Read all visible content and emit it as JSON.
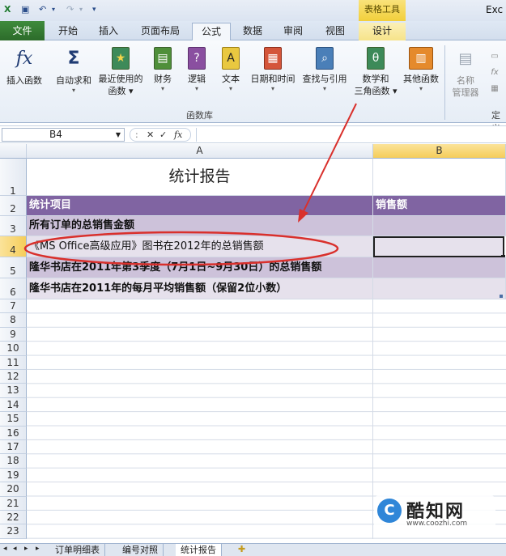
{
  "app": {
    "title": "Exc"
  },
  "qat": {
    "save_icon": "save-icon",
    "undo_icon": "undo-icon",
    "redo_icon": "redo-icon"
  },
  "tabs": {
    "context_header": "表格工具",
    "items": [
      "文件",
      "开始",
      "插入",
      "页面布局",
      "公式",
      "数据",
      "审阅",
      "视图",
      "设计"
    ],
    "active": "公式"
  },
  "ribbon": {
    "buttons": [
      {
        "icon": "fx-icon",
        "label": "插入函数",
        "label2": ""
      },
      {
        "icon": "sigma-icon",
        "label": "自动求和",
        "label2": ""
      },
      {
        "icon": "star-book-icon",
        "label": "最近使用的",
        "label2": "函数"
      },
      {
        "icon": "finance-book-icon",
        "label": "财务",
        "label2": ""
      },
      {
        "icon": "logic-book-icon",
        "label": "逻辑",
        "label2": ""
      },
      {
        "icon": "text-book-icon",
        "label": "文本",
        "label2": ""
      },
      {
        "icon": "datetime-book-icon",
        "label": "日期和时间",
        "label2": ""
      },
      {
        "icon": "lookup-book-icon",
        "label": "查找与引用",
        "label2": ""
      },
      {
        "icon": "math-book-icon",
        "label": "数学和",
        "label2": "三角函数"
      },
      {
        "icon": "more-books-icon",
        "label": "其他函数",
        "label2": ""
      }
    ],
    "group_label": "函数库",
    "name_manager": {
      "label": "名称",
      "label2": "管理器"
    },
    "partial_group": "定义"
  },
  "formula_bar": {
    "name_box": "B4",
    "fx_label": "fx",
    "value": ""
  },
  "grid": {
    "col_headers": [
      "A",
      "B"
    ],
    "selected_col": "B",
    "row_headers": [
      "1",
      "2",
      "3",
      "4",
      "5",
      "6",
      "7",
      "8",
      "9",
      "10",
      "11",
      "12",
      "13",
      "14",
      "15",
      "16",
      "17",
      "18",
      "19",
      "20",
      "21",
      "22",
      "23"
    ],
    "selected_row": "4",
    "title": "统计报告",
    "table_header": {
      "item": "统计项目",
      "amount": "销售额"
    },
    "rows": [
      {
        "item": "所有订单的总销售金额",
        "amount": ""
      },
      {
        "item": "《MS Office高级应用》图书在2012年的总销售额",
        "amount": ""
      },
      {
        "item": "隆华书店在2011年第3季度（7月1日~9月30日）的总销售额",
        "amount": ""
      },
      {
        "item": "隆华书店在2011年的每月平均销售额（保留2位小数）",
        "amount": ""
      }
    ]
  },
  "sheets": {
    "tabs": [
      "订单明细表",
      "编号对照",
      "统计报告"
    ],
    "active": "统计报告"
  },
  "watermark": {
    "name": "酷知网",
    "url": "www.coozhi.com"
  },
  "colors": {
    "header_purple": "#8064a2",
    "row_lavender_dark": "#cdc2da",
    "row_lavender_light": "#e6e1ec",
    "annotation_red": "#d9302c",
    "file_tab_green": "#2c6b2a"
  }
}
